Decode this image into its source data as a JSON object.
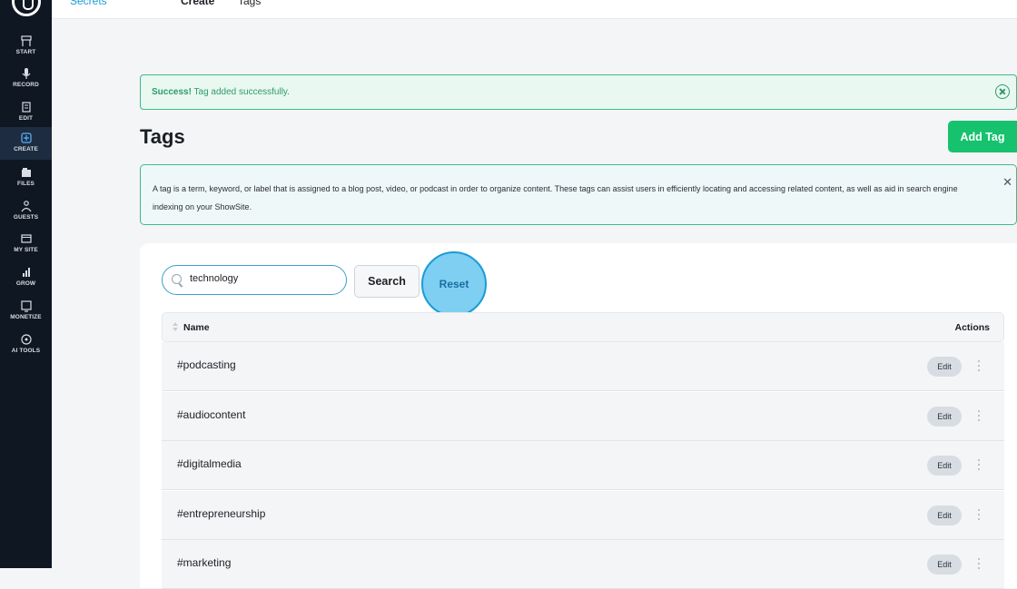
{
  "sidebar": {
    "items": [
      {
        "label": "START",
        "icon": "start-icon"
      },
      {
        "label": "RECORD",
        "icon": "microphone-icon"
      },
      {
        "label": "EDIT",
        "icon": "edit-icon"
      },
      {
        "label": "CREATE",
        "icon": "create-icon",
        "active": true
      },
      {
        "label": "FILES",
        "icon": "files-icon"
      },
      {
        "label": "GUESTS",
        "icon": "guests-icon"
      },
      {
        "label": "MY SITE",
        "icon": "my-site-icon"
      },
      {
        "label": "GROW",
        "icon": "grow-icon"
      },
      {
        "label": "MONETIZE",
        "icon": "monetize-icon"
      },
      {
        "label": "AI TOOLS",
        "icon": "ai-tools-icon"
      }
    ]
  },
  "breadcrumb": {
    "part1": "Secrets",
    "part2": "Create",
    "part3": "Tags"
  },
  "alert": {
    "strong": "Success!",
    "message": "Tag added successfully."
  },
  "page": {
    "title": "Tags",
    "add_button": "Add Tag"
  },
  "info": {
    "text": "A tag is a term, keyword, or label that is assigned to a blog post, video, or podcast in order to organize content. These tags can assist users in efficiently locating and accessing related content, as well as aid in search engine indexing on your ShowSite."
  },
  "search": {
    "value": "technology",
    "search_label": "Search",
    "reset_label": "Reset"
  },
  "table": {
    "headers": {
      "name": "Name",
      "actions": "Actions"
    },
    "edit_label": "Edit",
    "rows": [
      {
        "name": "#podcasting"
      },
      {
        "name": "#audiocontent"
      },
      {
        "name": "#digitalmedia"
      },
      {
        "name": "#entrepreneurship"
      },
      {
        "name": "#marketing"
      }
    ]
  },
  "colors": {
    "accent": "#16c26d",
    "sidebar": "#0f1722",
    "reset_highlight": "#7ecff1"
  }
}
